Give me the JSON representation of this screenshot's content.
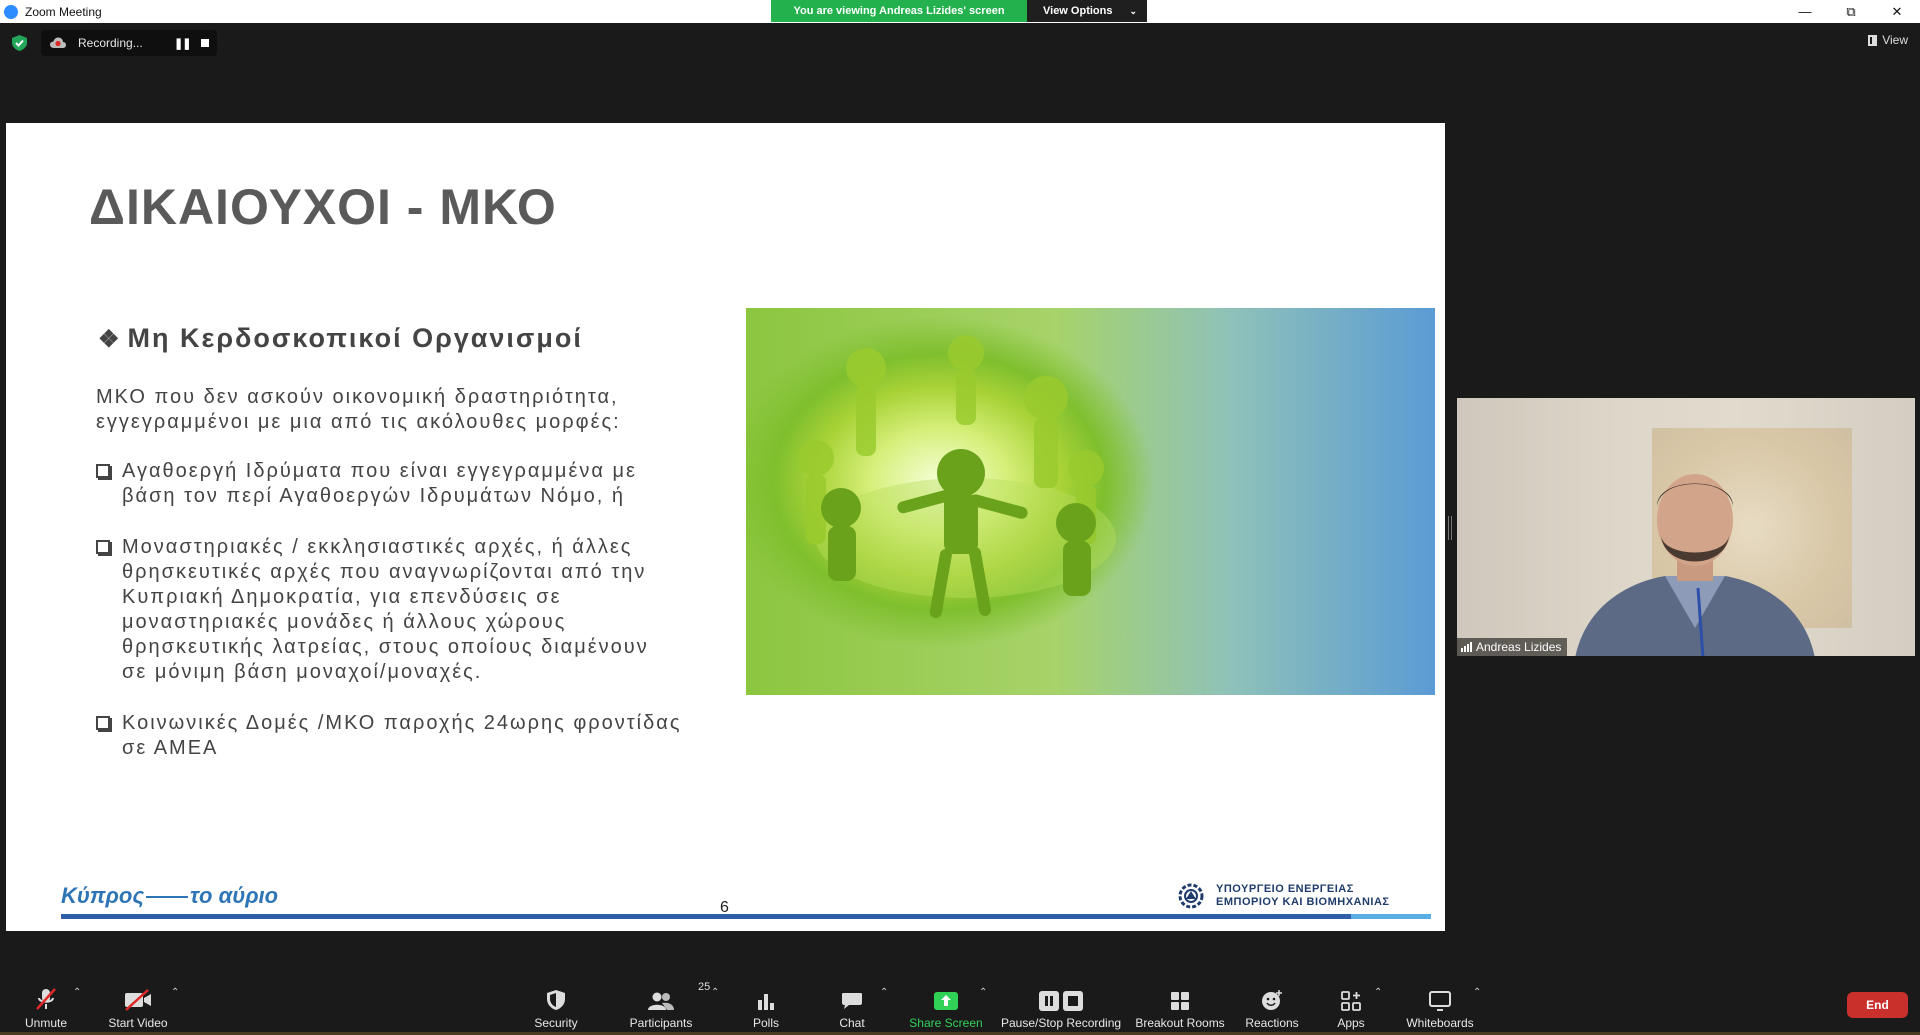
{
  "window": {
    "title": "Zoom Meeting"
  },
  "share_banner": {
    "viewing_text": "You are viewing Andreas Lizides' screen",
    "view_options": "View Options"
  },
  "recording": {
    "label": "Recording..."
  },
  "view_button": "View",
  "slide": {
    "title": "ΔΙΚΑΙΟΥΧΟΙ - ΜΚΟ",
    "subtitle_glyph": "❖",
    "subtitle": "Μη Κερδοσκοπικοί Οργανισμοί",
    "intro_line1": "ΜΚΟ που δεν ασκούν οικονομική δραστηριότητα,",
    "intro_line2": "εγγεγραμμένοι με μια από τις ακόλουθες μορφές:",
    "bullets": [
      {
        "lines": [
          "Αγαθοεργή Ιδρύματα που είναι εγγεγραμμένα με",
          "βάση τον περί Αγαθοεργών Ιδρυμάτων Νόμο, ή"
        ]
      },
      {
        "lines": [
          "Μοναστηριακές / εκκλησιαστικές αρχές, ή άλλες",
          "θρησκευτικές αρχές που αναγνωρίζονται από την",
          "Κυπριακή Δημοκρατία, για επενδύσεις σε",
          "μοναστηριακές μονάδες ή άλλους χώρους",
          "θρησκευτικής λατρείας, στους οποίους διαμένουν",
          "σε μόνιμη βάση μοναχοί/μοναχές."
        ]
      },
      {
        "lines": [
          "Κοινωνικές Δομές /ΜΚΟ παροχής 24ωρης φροντίδας",
          "σε ΑΜΕΑ"
        ]
      }
    ],
    "footer_logo_left": "Κύπρος",
    "footer_logo_right": "το αύριο",
    "page_number": "6",
    "ministry_line1": "ΥΠΟΥΡΓΕΙΟ ΕΝΕΡΓΕΙΑΣ",
    "ministry_line2": "ΕΜΠΟΡΙΟΥ ΚΑΙ ΒΙΟΜΗΧΑΝΙΑΣ"
  },
  "participant": {
    "name": "Andreas Lizides"
  },
  "toolbar": {
    "unmute": "Unmute",
    "start_video": "Start Video",
    "security": "Security",
    "participants": "Participants",
    "participants_count": "25",
    "polls": "Polls",
    "chat": "Chat",
    "share_screen": "Share Screen",
    "pause_stop_recording": "Pause/Stop Recording",
    "breakout_rooms": "Breakout Rooms",
    "reactions": "Reactions",
    "apps": "Apps",
    "whiteboards": "Whiteboards",
    "end": "End"
  },
  "colors": {
    "share_green": "#22b14c",
    "end_red": "#c9302c",
    "slide_title": "#5a5a5a",
    "logo_blue": "#2e75b6"
  }
}
